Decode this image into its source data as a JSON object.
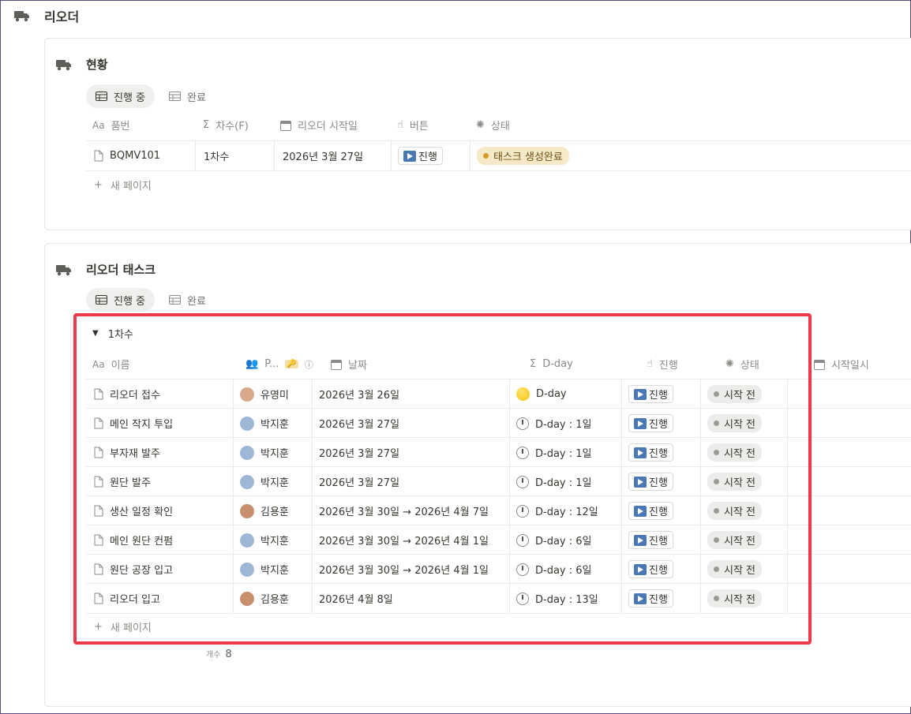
{
  "page": {
    "title": "리오더"
  },
  "status_card": {
    "title": "현황",
    "tabs": [
      {
        "label": "진행 중"
      },
      {
        "label": "완료"
      }
    ],
    "columns": [
      "품번",
      "차수(F)",
      "리오더 시작일",
      "버튼",
      "상태"
    ],
    "row": {
      "code": "BQMV101",
      "round": "1차수",
      "start": "2026년 3월 27일",
      "button": "진행",
      "status": "태스크 생성완료"
    },
    "new_page": "새 페이지"
  },
  "task_card": {
    "title": "리오더 태스크",
    "tabs": [
      {
        "label": "진행 중"
      },
      {
        "label": "완료"
      }
    ],
    "group": "1차수",
    "columns": [
      "이름",
      "P...",
      "날짜",
      "D-day",
      "진행",
      "상태",
      "시작일시"
    ],
    "rows": [
      {
        "name": "리오더 접수",
        "person": "유영미",
        "date": "2026년 3월 26일",
        "dday": "D-day",
        "dday_icon": "sun-icon",
        "button": "진행",
        "status": "시작 전"
      },
      {
        "name": "메인 작지 투입",
        "person": "박지훈",
        "date": "2026년 3월 27일",
        "dday": "D-day : 1일",
        "dday_icon": "clock-icon",
        "button": "진행",
        "status": "시작 전"
      },
      {
        "name": "부자재 발주",
        "person": "박지훈",
        "date": "2026년 3월 27일",
        "dday": "D-day : 1일",
        "dday_icon": "clock-icon",
        "button": "진행",
        "status": "시작 전"
      },
      {
        "name": "원단 발주",
        "person": "박지훈",
        "date": "2026년 3월 27일",
        "dday": "D-day : 1일",
        "dday_icon": "clock-icon",
        "button": "진행",
        "status": "시작 전"
      },
      {
        "name": "생산 일정 확인",
        "person": "김용훈",
        "date": "2026년 3월 30일 → 2026년 4월 7일",
        "dday": "D-day : 12일",
        "dday_icon": "clock-icon",
        "button": "진행",
        "status": "시작 전"
      },
      {
        "name": "메인 원단 컨펌",
        "person": "박지훈",
        "date": "2026년 3월 30일 → 2026년 4월 1일",
        "dday": "D-day : 6일",
        "dday_icon": "clock-icon",
        "button": "진행",
        "status": "시작 전"
      },
      {
        "name": "원단 공장 입고",
        "person": "박지훈",
        "date": "2026년 3월 30일 → 2026년 4월 1일",
        "dday": "D-day : 6일",
        "dday_icon": "clock-icon",
        "button": "진행",
        "status": "시작 전"
      },
      {
        "name": "리오더 입고",
        "person": "김용훈",
        "date": "2026년 4월 8일",
        "dday": "D-day : 13일",
        "dday_icon": "clock-icon",
        "button": "진행",
        "status": "시작 전"
      }
    ],
    "new_page": "새 페이지",
    "count_label": "개수",
    "count_value": "8"
  },
  "colors": {
    "highlight": "#ed3a4a",
    "status_done_bg": "#f6e9c7",
    "status_todo_bg": "#ececeb",
    "play_blue": "#4a78b5"
  }
}
